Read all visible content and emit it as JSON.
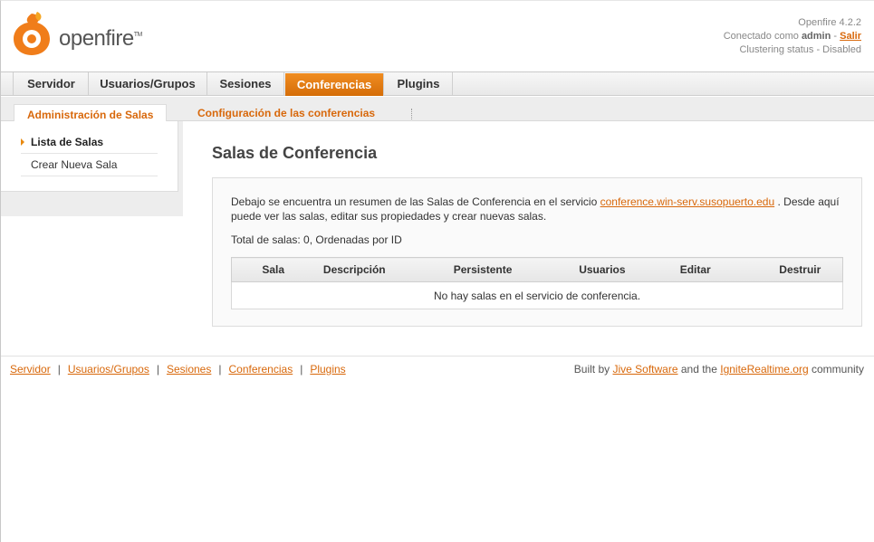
{
  "header": {
    "logo_text": "openfire",
    "version": "Openfire 4.2.2",
    "connected_prefix": "Conectado como",
    "username": "admin",
    "logout_separator": "-",
    "logout_label": "Salir",
    "clustering": "Clustering status - Disabled"
  },
  "main_nav": {
    "tabs": [
      "Servidor",
      "Usuarios/Grupos",
      "Sesiones",
      "Conferencias",
      "Plugins"
    ],
    "active": "Conferencias"
  },
  "sub_nav": {
    "tabs": [
      "Administración de Salas",
      "Configuración de las conferencias"
    ],
    "active": "Administración de Salas"
  },
  "sidebar": {
    "items": [
      "Lista de Salas",
      "Crear Nueva Sala"
    ],
    "active": "Lista de Salas"
  },
  "content": {
    "title": "Salas de Conferencia",
    "intro_before_link": "Debajo se encuentra un resumen de las Salas de Conferencia en el servicio",
    "service_link": "conference.win-serv.susopuerto.edu",
    "intro_after_link": ". Desde aquí puede ver las salas, editar sus propiedades y crear nuevas salas.",
    "total": "Total de salas: 0, Ordenadas por ID",
    "table": {
      "columns": [
        "Sala",
        "Descripción",
        "Persistente",
        "Usuarios",
        "Editar",
        "Destruir"
      ],
      "empty_message": "No hay salas en el servicio de conferencia."
    }
  },
  "footer": {
    "links": [
      "Servidor",
      "Usuarios/Grupos",
      "Sesiones",
      "Conferencias",
      "Plugins"
    ],
    "separator": "|",
    "credit_prefix": "Built by",
    "credit_link1": "Jive Software",
    "credit_middle": "and the",
    "credit_link2": "IgniteRealtime.org",
    "credit_suffix": "community"
  },
  "colors": {
    "accent": "#d8680b",
    "active_tab": "#e8800f"
  },
  "icons": {
    "logo": "openfire-flame-logo",
    "sidebar_active": "triangle-right-icon"
  }
}
